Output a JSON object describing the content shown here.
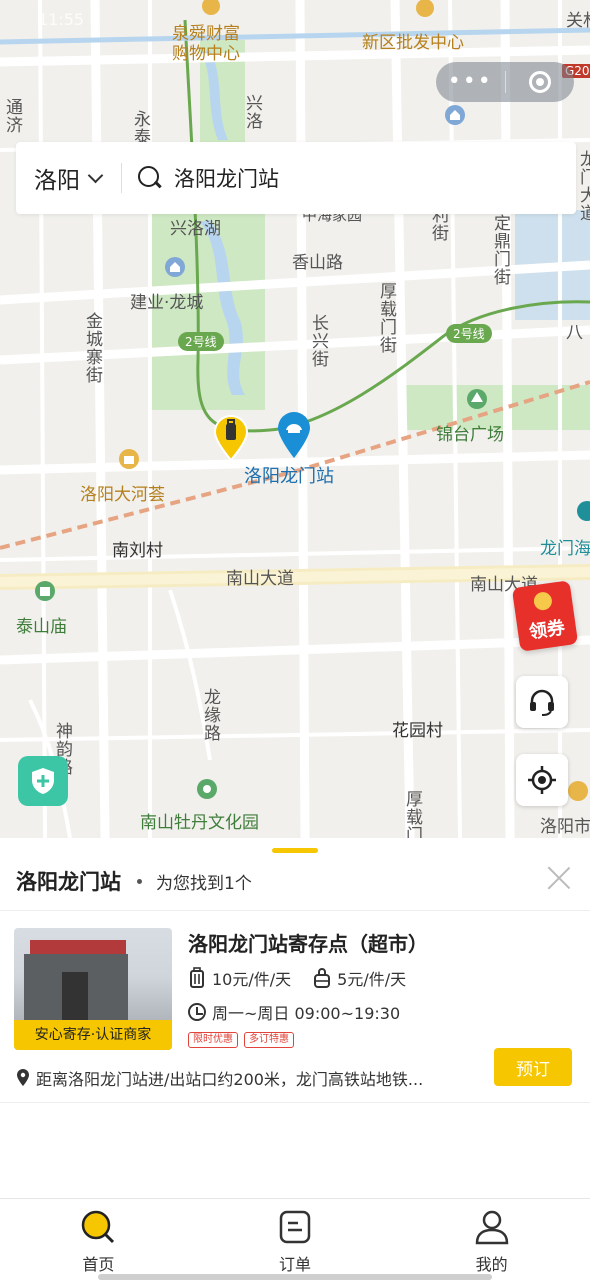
{
  "status_bar": {
    "time": "11:55"
  },
  "capsule": {
    "more_label": "•••"
  },
  "search": {
    "city": "洛阳",
    "query": "洛阳龙门站"
  },
  "map": {
    "labels": {
      "quanshun": "泉舜财富\n购物中心",
      "xinqu": "新区批发中心",
      "guan": "关林",
      "tongji": "通济",
      "yong": "永泰",
      "xingluo_top": "兴洛",
      "xingluo_lake": "兴洛湖",
      "zhongzhou_jiayuan": "中海家园",
      "xiangshan_rd": "香山路",
      "jianye": "建业·龙城",
      "jincheng": "金城寨街",
      "houzai": "厚载门街",
      "changxing": "长兴街",
      "dingding": "定鼎门街",
      "longmen_right": "龙门大道",
      "li": "利街",
      "line2_a": "2号线",
      "line2_b": "2号线",
      "ba": "八",
      "jintai": "锦台广场",
      "station": "洛阳龙门站",
      "dahehui": "洛阳大河荟",
      "nanliu": "南刘村",
      "nanshan_rd": "南山大道",
      "nanshan_rd2": "南山大道",
      "longmen_hai": "龙门海",
      "taishan": "泰山庙",
      "longyuan": "龙缘路",
      "shenyao": "神韵路",
      "huayuan": "花园村",
      "houzai2": "厚载门",
      "peony": "南山牡丹文化园",
      "luoyang_shi": "洛阳市"
    },
    "coupon_label": "领券",
    "highway_badge": "G20"
  },
  "sheet": {
    "title": "洛阳龙门站",
    "result_text": "为您找到1个",
    "card": {
      "name": "洛阳龙门站寄存点（超市）",
      "price_large": "10元/件/天",
      "price_small": "5元/件/天",
      "hours": "周一~周日 09:00~19:30",
      "tags": [
        "限时优惠",
        "多订特惠"
      ],
      "badge": "安心寄存·认证商家",
      "address": "距离洛阳龙门站进/出站口约200米，龙门高铁站地铁...",
      "book_label": "预订"
    }
  },
  "tabs": [
    {
      "label": "首页",
      "icon": "search-icon",
      "active": true
    },
    {
      "label": "订单",
      "icon": "order-icon",
      "active": false
    },
    {
      "label": "我的",
      "icon": "profile-icon",
      "active": false
    }
  ],
  "colors": {
    "accent": "#f6c600",
    "pin_blue": "#1a8fd6",
    "metro_green": "#6aa84f",
    "rail": "#e6a482",
    "park_green": "#cfe8c4",
    "water": "#b7d5ee"
  }
}
